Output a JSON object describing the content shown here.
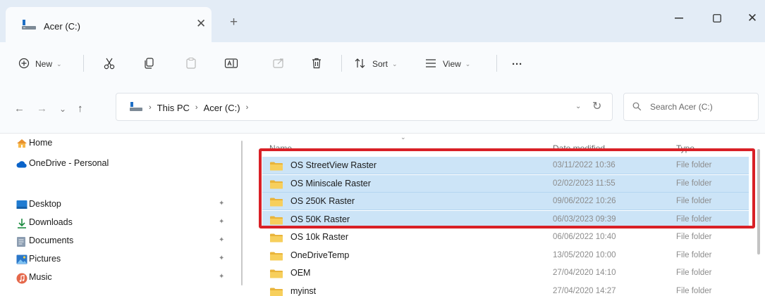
{
  "window": {
    "tab_title": "Acer (C:)",
    "tab_close": "✕",
    "new_tab": "+",
    "minimize": "—",
    "maximize": "☐",
    "close": "✕"
  },
  "toolbar": {
    "new_label": "New",
    "sort_label": "Sort",
    "view_label": "View",
    "more_label": "···",
    "chevron": "⌄",
    "icons": [
      "plus-circle-icon",
      "cut-icon",
      "copy-icon",
      "paste-icon",
      "rename-icon",
      "share-icon",
      "delete-icon",
      "sort-icon",
      "view-icon",
      "more-icon"
    ]
  },
  "address": {
    "back": "←",
    "forward": "→",
    "recent": "⌄",
    "up": "↑",
    "crumbs": [
      "This PC",
      "Acer (C:)"
    ],
    "crumb_sep": "›",
    "dropdown": "⌄",
    "refresh": "↻",
    "search_placeholder": "Search Acer (C:)"
  },
  "nav_pane": {
    "items": [
      {
        "label": "Home",
        "icon": "home-icon",
        "pinned": false
      },
      {
        "label": "OneDrive - Personal",
        "icon": "onedrive-cloud-icon",
        "pinned": false
      },
      {
        "label": "Desktop",
        "icon": "desktop-icon",
        "pinned": true
      },
      {
        "label": "Downloads",
        "icon": "download-icon",
        "pinned": true
      },
      {
        "label": "Documents",
        "icon": "documents-icon",
        "pinned": true
      },
      {
        "label": "Pictures",
        "icon": "pictures-icon",
        "pinned": true
      },
      {
        "label": "Music",
        "icon": "music-icon",
        "pinned": true
      }
    ],
    "pin_glyph": "✦"
  },
  "file_list": {
    "columns": {
      "name": "Name",
      "date": "Date modified",
      "type": "Type"
    },
    "rows": [
      {
        "name": "OS StreetView Raster",
        "date": "03/11/2022 10:36",
        "type": "File folder",
        "selected": true
      },
      {
        "name": "OS Miniscale Raster",
        "date": "02/02/2023 11:55",
        "type": "File folder",
        "selected": true
      },
      {
        "name": "OS 250K Raster",
        "date": "09/06/2022 10:26",
        "type": "File folder",
        "selected": true
      },
      {
        "name": "OS 50K Raster",
        "date": "06/03/2023 09:39",
        "type": "File folder",
        "selected": true
      },
      {
        "name": "OS 10k Raster",
        "date": "06/06/2022 10:40",
        "type": "File folder",
        "selected": false
      },
      {
        "name": "OneDriveTemp",
        "date": "13/05/2020 10:00",
        "type": "File folder",
        "selected": false
      },
      {
        "name": "OEM",
        "date": "27/04/2020 14:10",
        "type": "File folder",
        "selected": false
      },
      {
        "name": "myinst",
        "date": "27/04/2020 14:27",
        "type": "File folder",
        "selected": false
      }
    ]
  },
  "colors": {
    "titlebar_bg": "#e3ecf6",
    "selection_bg": "#cce4f7",
    "highlight_border": "#d92026",
    "folder_yellow": "#f2c94c"
  }
}
